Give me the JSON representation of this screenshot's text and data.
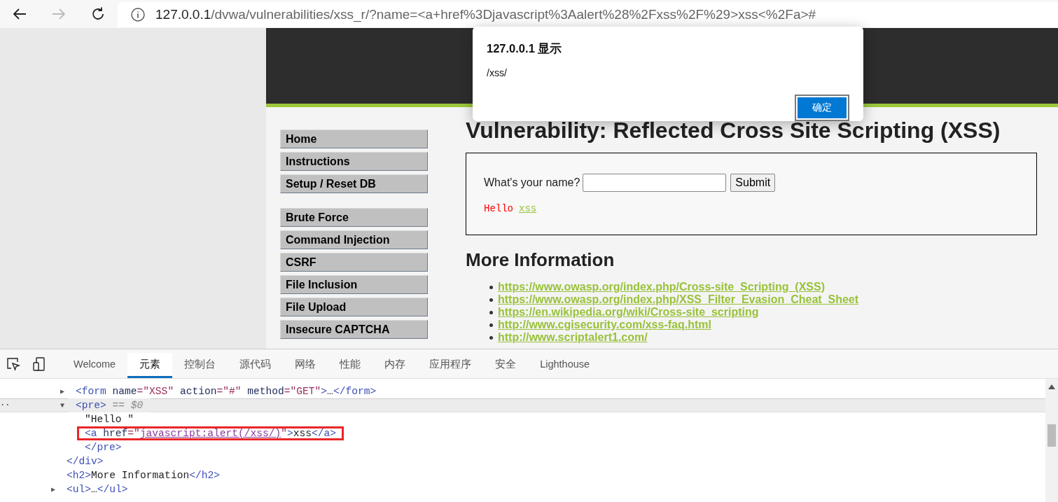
{
  "toolbar": {
    "url_host": "127.0.0.1",
    "url_path": "/dvwa/vulnerabilities/xss_r/?name=<a+href%3Djavascript%3Aalert%28%2Fxss%2F%29>xss<%2Fa>#"
  },
  "menu": {
    "groups": [
      [
        {
          "label": "Home"
        },
        {
          "label": "Instructions"
        },
        {
          "label": "Setup / Reset DB"
        }
      ],
      [
        {
          "label": "Brute Force"
        },
        {
          "label": "Command Injection"
        },
        {
          "label": "CSRF"
        },
        {
          "label": "File Inclusion"
        },
        {
          "label": "File Upload"
        },
        {
          "label": "Insecure CAPTCHA"
        }
      ]
    ]
  },
  "heading": "Vulnerability: Reflected Cross Site Scripting (XSS)",
  "form": {
    "label": "What's your name?",
    "button": "Submit"
  },
  "output": {
    "text": "Hello",
    "link": "xss"
  },
  "more_info": {
    "title": "More Information",
    "links": [
      "https://www.owasp.org/index.php/Cross-site_Scripting_(XSS)",
      "https://www.owasp.org/index.php/XSS_Filter_Evasion_Cheat_Sheet",
      "https://en.wikipedia.org/wiki/Cross-site_scripting",
      "http://www.cgisecurity.com/xss-faq.html",
      "http://www.scriptalert1.com/"
    ]
  },
  "dialog": {
    "title": "127.0.0.1 显示",
    "message": "/xss/",
    "button": "确定"
  },
  "devtools": {
    "tabs": [
      {
        "label": "Welcome",
        "selected": false
      },
      {
        "label": "元素",
        "selected": true
      },
      {
        "label": "控制台",
        "selected": false
      },
      {
        "label": "源代码",
        "selected": false
      },
      {
        "label": "网络",
        "selected": false
      },
      {
        "label": "性能",
        "selected": false
      },
      {
        "label": "内存",
        "selected": false
      },
      {
        "label": "应用程序",
        "selected": false
      },
      {
        "label": "安全",
        "selected": false
      },
      {
        "label": "Lighthouse",
        "selected": false
      }
    ],
    "tree": [
      {
        "children": [
          {
            "toggle": "▶",
            "selected": false,
            "highlighted": false,
            "tokens": [
              {
                "kind": "tag",
                "text": "<form"
              },
              {
                "kind": "attr",
                "text": " name"
              },
              {
                "kind": "value",
                "text": "=\"XSS\""
              },
              {
                "kind": "attr",
                "text": " action"
              },
              {
                "kind": "value",
                "text": "=\"#\""
              },
              {
                "kind": "attr",
                "text": " method"
              },
              {
                "kind": "value",
                "text": "=\"GET\""
              },
              {
                "kind": "tag",
                "text": ">"
              },
              {
                "kind": "text",
                "text": "…"
              },
              {
                "kind": "tag",
                "text": "</form>"
              }
            ]
          },
          {
            "toggle": "▼",
            "gutter": "··",
            "selected": true,
            "highlighted": false,
            "tokens": [
              {
                "kind": "tag",
                "text": "<pre>"
              },
              {
                "kind": "comment",
                "text": " == $0"
              }
            ],
            "children": [
              {
                "selected": false,
                "highlighted": false,
                "tokens": [
                  {
                    "kind": "text",
                    "text": "\"Hello \""
                  }
                ]
              },
              {
                "selected": false,
                "highlighted": true,
                "tokens": [
                  {
                    "kind": "tag",
                    "text": "<a"
                  },
                  {
                    "kind": "attr",
                    "text": " href"
                  },
                  {
                    "kind": "value",
                    "text": "=\""
                  },
                  {
                    "kind": "link",
                    "text": "javascript:alert(/xss/)"
                  },
                  {
                    "kind": "value",
                    "text": "\""
                  },
                  {
                    "kind": "tag",
                    "text": ">"
                  },
                  {
                    "kind": "text",
                    "text": "xss"
                  },
                  {
                    "kind": "tag",
                    "text": "</a>"
                  }
                ]
              }
            ],
            "closing": [
              {
                "kind": "tag",
                "text": "</pre>"
              }
            ]
          }
        ],
        "closing": [
          {
            "kind": "tag",
            "text": "</div>"
          }
        ]
      },
      {
        "selected": false,
        "highlighted": false,
        "tokens": [
          {
            "kind": "tag",
            "text": "<h2>"
          },
          {
            "kind": "text",
            "text": "More Information"
          },
          {
            "kind": "tag",
            "text": "</h2>"
          }
        ]
      },
      {
        "toggle": "▶",
        "selected": false,
        "highlighted": false,
        "tokens": [
          {
            "kind": "tag",
            "text": "<ul>"
          },
          {
            "kind": "text",
            "text": "…"
          },
          {
            "kind": "tag",
            "text": "</ul>"
          }
        ]
      }
    ]
  }
}
